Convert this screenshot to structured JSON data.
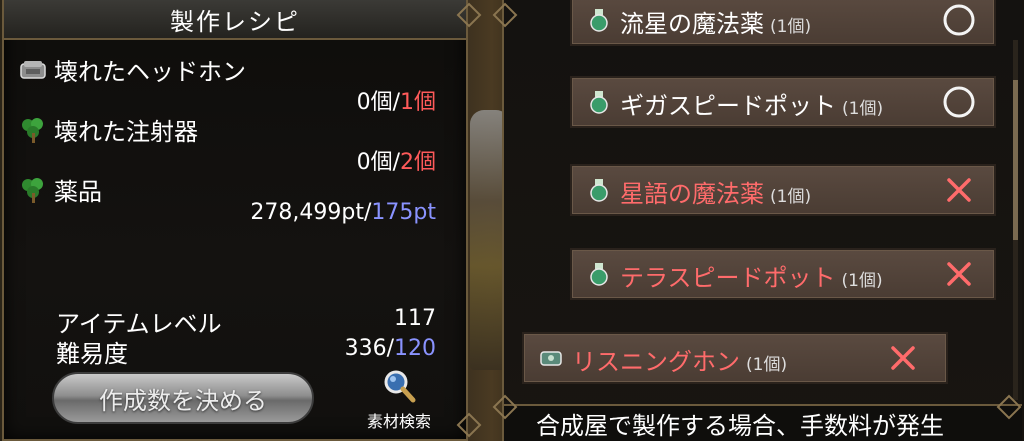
{
  "left": {
    "title": "製作レシピ",
    "materials": [
      {
        "name": "壊れたヘッドホン",
        "icon": "headphone-material-icon",
        "have": "0個/",
        "need": "1個"
      },
      {
        "name": "壊れた注射器",
        "icon": "herb-icon",
        "have": "0個/",
        "need": "2個"
      },
      {
        "name": "薬品",
        "icon": "herb-icon",
        "have": "278,499pt/",
        "need": "175pt"
      }
    ],
    "item_level_label": "アイテムレベル",
    "item_level_value": "117",
    "difficulty_label": "難易度",
    "difficulty_have": "336/",
    "difficulty_need": "120",
    "make_button": "作成数を決める",
    "search_label": "素材検索"
  },
  "recipes": [
    {
      "name": "流星の魔法薬",
      "count": "(1個)",
      "status": "circle",
      "craftable": true
    },
    {
      "name": "ギガスピードポット",
      "count": "(1個)",
      "status": "circle",
      "craftable": true
    },
    {
      "name": "星語の魔法薬",
      "count": "(1個)",
      "status": "cross",
      "craftable": false
    },
    {
      "name": "テラスピードポット",
      "count": "(1個)",
      "status": "cross",
      "craftable": false
    },
    {
      "name": "リスニングホン",
      "count": "(1個)",
      "status": "cross",
      "craftable": false,
      "selected": true
    }
  ],
  "footer": "合成屋で製作する場合、手数料が発生",
  "colors": {
    "need": "#ff5a5a",
    "highlight": "#8a93ff",
    "uncraftable": "#ff6b6b",
    "cross": "#ff6b6b"
  }
}
